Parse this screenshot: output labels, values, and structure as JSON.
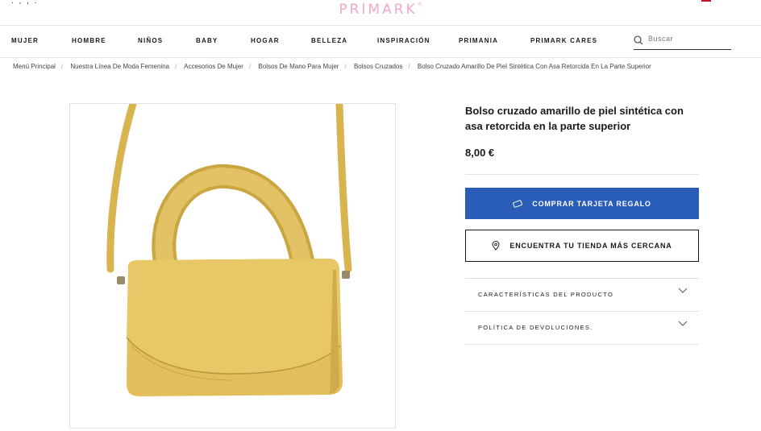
{
  "header": {
    "logo": "PRIMARK",
    "logo_mark": "®"
  },
  "nav": {
    "items": [
      "MUJER",
      "HOMBRE",
      "NIÑOS",
      "BABY",
      "HOGAR",
      "BELLEZA",
      "INSPIRACIÓN",
      "PRIMANIA",
      "PRIMARK CARES"
    ],
    "search_placeholder": "Buscar"
  },
  "breadcrumb": [
    "Menú Principal",
    "Nuestra Línea De Moda Femenina",
    "Accesorios De Mujer",
    "Bolsos De Mano Para Mujer",
    "Bolsos Cruzados",
    "Bolso Cruzado Amarillo De Piel Sintética Con Asa Retorcida En La Parte Superior"
  ],
  "product": {
    "title": "Bolso cruzado amarillo de piel sintética con asa retorcida en la parte superior",
    "price": "8,00 €",
    "bag_color": "#e2bf5a",
    "buttons": {
      "gift_card": "COMPRAR TARJETA REGALO",
      "store": "ENCUENTRA TU TIENDA MÁS CERCANA"
    },
    "accordion": [
      "CARACTERÍSTICAS DEL PRODUCTO",
      "POLÍTICA DE DEVOLUCIONES."
    ]
  },
  "colors": {
    "primary_button": "#2a5db8",
    "logo": "#f3a7c6"
  }
}
